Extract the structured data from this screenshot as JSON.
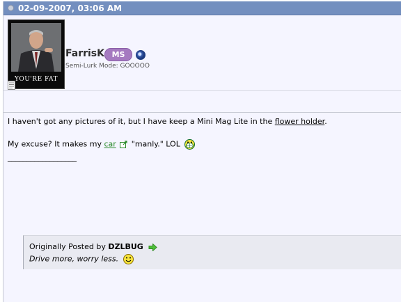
{
  "post": {
    "date": "02-09-2007, 03:06 AM"
  },
  "user": {
    "name": "FarrisK",
    "badge": "MS",
    "title": "Semi-Lurk Mode: GOOOOO",
    "avatar_caption": "YOU'RE FAT"
  },
  "message": {
    "line1_pre": "I haven't got any pictures of it, but I have keep a Mini Mag Lite in the ",
    "line1_link": "flower holder",
    "line1_post": ".",
    "line2_pre": "My excuse? It makes my ",
    "line2_link": "car",
    "line2_post": " \"manly.\" LOL",
    "signature_rule": "__________________"
  },
  "quote": {
    "prefix": "Originally Posted by",
    "author": "DZLBUG",
    "text": "Drive more, worry less."
  }
}
